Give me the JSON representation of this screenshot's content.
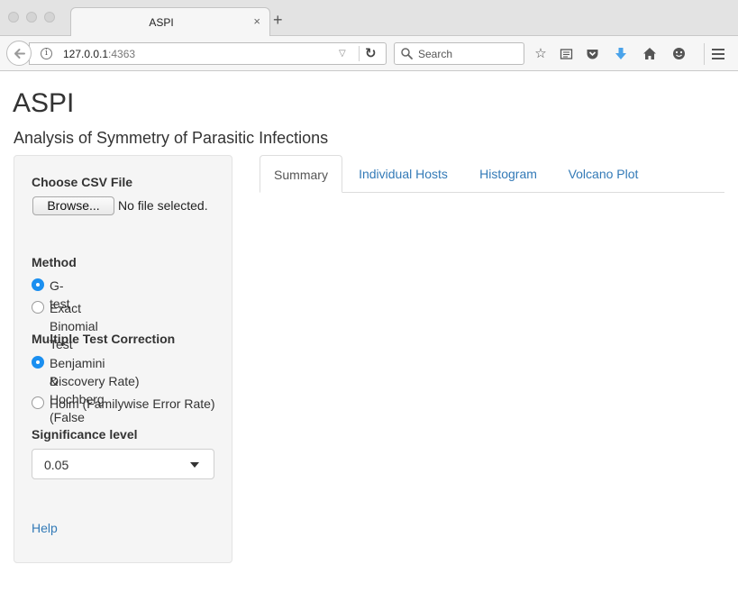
{
  "browser": {
    "tab_title": "ASPI",
    "tab_close": "×",
    "new_tab": "+",
    "url_host": "127.0.0.1",
    "url_port": ":4363",
    "search_placeholder": "Search"
  },
  "app": {
    "title": "ASPI",
    "subtitle": "Analysis of Symmetry of Parasitic Infections"
  },
  "sidebar": {
    "file_label": "Choose CSV File",
    "browse_label": "Browse...",
    "no_file_text": "No file selected.",
    "method_label": "Method",
    "method_options": [
      {
        "label": "G-test",
        "selected": true
      },
      {
        "label": "Exact Binomial Test",
        "selected": false
      }
    ],
    "correction_label": "Multiple Test Correction",
    "correction_options": [
      {
        "label": "Benjamini & Hochberg (False",
        "label2": "Discovery Rate)",
        "selected": true
      },
      {
        "label": "Holm (Familywise Error Rate)",
        "selected": false
      }
    ],
    "significance_label": "Significance level",
    "significance_value": "0.05",
    "help_link": "Help"
  },
  "tabs": [
    {
      "label": "Summary",
      "active": true
    },
    {
      "label": "Individual Hosts",
      "active": false
    },
    {
      "label": "Histogram",
      "active": false
    },
    {
      "label": "Volcano Plot",
      "active": false
    }
  ],
  "colors": {
    "link": "#337ab7",
    "radio_selected": "#1b8ff0",
    "download_arrow": "#4aa3ea"
  }
}
